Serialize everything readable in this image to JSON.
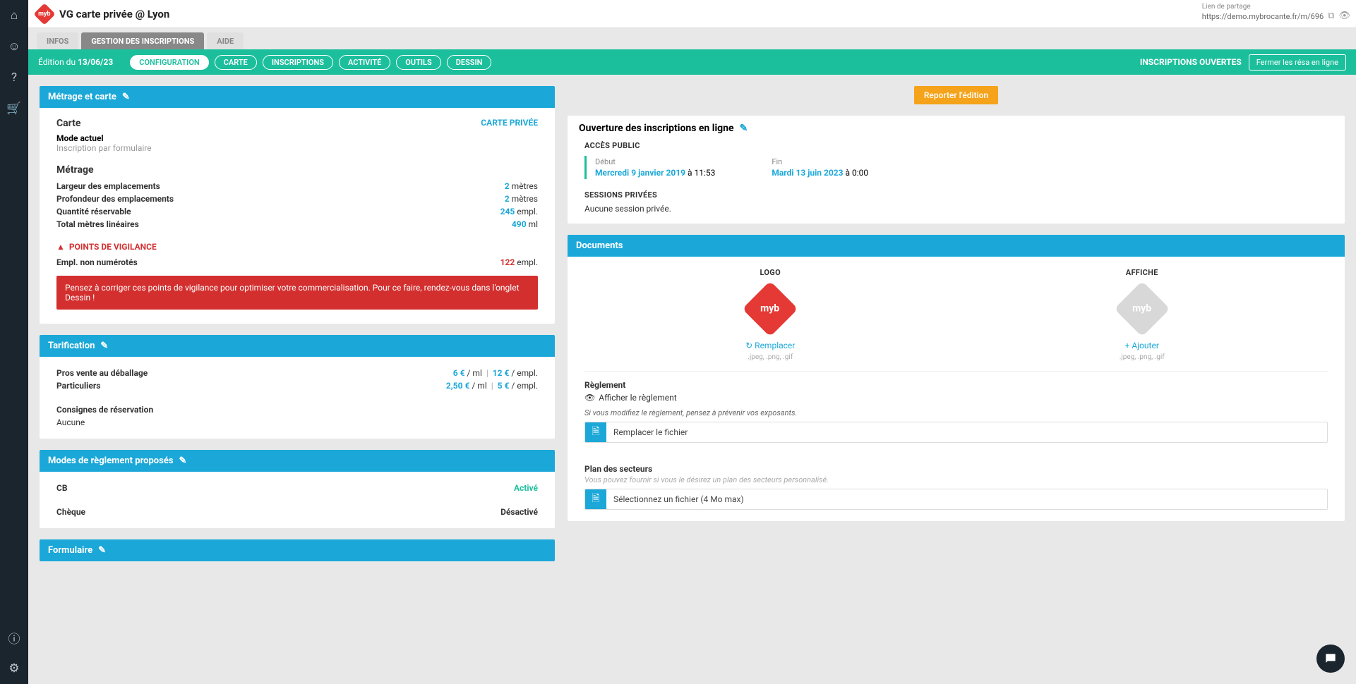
{
  "header": {
    "title": "VG carte privée @ Lyon",
    "share_label": "Lien de partage",
    "share_url": "https://demo.mybrocante.fr/m/696"
  },
  "tabs": {
    "infos": "INFOS",
    "gestion": "GESTION DES INSCRIPTIONS",
    "aide": "AIDE"
  },
  "toolbar": {
    "edition_prefix": "Édition du ",
    "edition_date": "13/06/23",
    "pills": {
      "config": "CONFIGURATION",
      "carte": "CARTE",
      "inscriptions": "INSCRIPTIONS",
      "activite": "ACTIVITÉ",
      "outils": "OUTILS",
      "dessin": "DESSIN"
    },
    "status": "INSCRIPTIONS OUVERTES",
    "close_resa": "Fermer les résa en ligne"
  },
  "metrage": {
    "header": "Métrage et carte",
    "carte_title": "Carte",
    "mode_label": "Mode actuel",
    "mode_sub": "Inscription par formulaire",
    "carte_link": "CARTE PRIVÉE",
    "metrage_title": "Métrage",
    "rows": {
      "largeur": {
        "label": "Largeur des emplacements",
        "val": "2",
        "unit": " mètres"
      },
      "profondeur": {
        "label": "Profondeur des emplacements",
        "val": "2",
        "unit": " mètres"
      },
      "quantite": {
        "label": "Quantité réservable",
        "val": "245",
        "unit": " empl."
      },
      "total": {
        "label": "Total mètres linéaires",
        "val": "490",
        "unit": " ml"
      }
    },
    "warn_title": "POINTS DE VIGILANCE",
    "warn_row": {
      "label": "Empl. non numérotés",
      "val": "122",
      "unit": " empl."
    },
    "alert": "Pensez à corriger ces points de vigilance pour optimiser votre commercialisation. Pour ce faire, rendez-vous dans l'onglet Dessin !"
  },
  "tarif": {
    "header": "Tarification",
    "pros": {
      "label": "Pros vente au déballage",
      "p1": "6 €",
      "u1": " / ml",
      "p2": "12 €",
      "u2": " / empl."
    },
    "part": {
      "label": "Particuliers",
      "p1": "2,50 €",
      "u1": " / ml",
      "p2": "5 €",
      "u2": " / empl."
    },
    "consignes_label": "Consignes de réservation",
    "consignes_val": "Aucune"
  },
  "modes": {
    "header": "Modes de règlement proposés",
    "cb": {
      "label": "CB",
      "status": "Activé"
    },
    "cheque": {
      "label": "Chèque",
      "status": "Désactivé"
    }
  },
  "formulaire": {
    "header": "Formulaire"
  },
  "report_btn": "Reporter l'édition",
  "ouverture": {
    "header": "Ouverture des inscriptions en ligne",
    "access": "ACCÈS PUBLIC",
    "debut_label": "Début",
    "debut_date": "Mercredi 9 janvier 2019",
    "debut_time": " à 11:53",
    "fin_label": "Fin",
    "fin_date": "Mardi 13 juin 2023",
    "fin_time": " à 0:00",
    "sessions_label": "SESSIONS PRIVÉES",
    "sessions_val": "Aucune session privée."
  },
  "docs": {
    "header": "Documents",
    "logo_title": "LOGO",
    "logo_action": "↻ Remplacer",
    "logo_hint": ".jpeg, .png, .gif",
    "affiche_title": "AFFICHE",
    "affiche_action": "+ Ajouter",
    "affiche_hint": ".jpeg, .png, .gif",
    "reg_title": "Règlement",
    "reg_link": "Afficher le règlement",
    "reg_note": "Si vous modifiez le règlement, pensez à prévenir vos exposants.",
    "reg_file": "Remplacer le fichier",
    "plan_title": "Plan des secteurs",
    "plan_note": "Vous pouvez fournir si vous le désirez un plan des secteurs personnalisé.",
    "plan_file": "Sélectionnez un fichier (4 Mo max)"
  }
}
